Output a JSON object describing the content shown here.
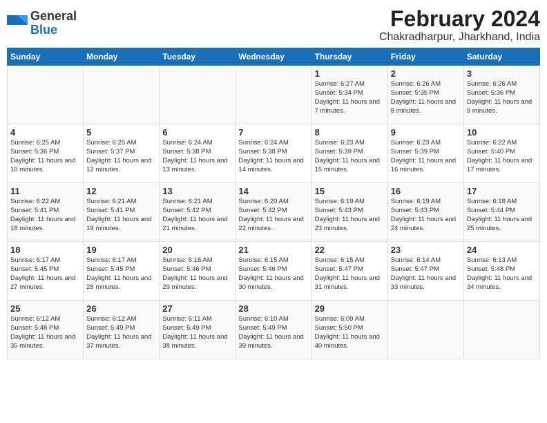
{
  "logo": {
    "general": "General",
    "blue": "Blue"
  },
  "title": "February 2024",
  "subtitle": "Chakradharpur, Jharkhand, India",
  "days_of_week": [
    "Sunday",
    "Monday",
    "Tuesday",
    "Wednesday",
    "Thursday",
    "Friday",
    "Saturday"
  ],
  "weeks": [
    [
      {
        "day": "",
        "text": ""
      },
      {
        "day": "",
        "text": ""
      },
      {
        "day": "",
        "text": ""
      },
      {
        "day": "",
        "text": ""
      },
      {
        "day": "1",
        "text": "Sunrise: 6:27 AM\nSunset: 5:34 PM\nDaylight: 11 hours and 7 minutes."
      },
      {
        "day": "2",
        "text": "Sunrise: 6:26 AM\nSunset: 5:35 PM\nDaylight: 11 hours and 8 minutes."
      },
      {
        "day": "3",
        "text": "Sunrise: 6:26 AM\nSunset: 5:36 PM\nDaylight: 11 hours and 9 minutes."
      }
    ],
    [
      {
        "day": "4",
        "text": "Sunrise: 6:25 AM\nSunset: 5:36 PM\nDaylight: 11 hours and 10 minutes."
      },
      {
        "day": "5",
        "text": "Sunrise: 6:25 AM\nSunset: 5:37 PM\nDaylight: 11 hours and 12 minutes."
      },
      {
        "day": "6",
        "text": "Sunrise: 6:24 AM\nSunset: 5:38 PM\nDaylight: 11 hours and 13 minutes."
      },
      {
        "day": "7",
        "text": "Sunrise: 6:24 AM\nSunset: 5:38 PM\nDaylight: 11 hours and 14 minutes."
      },
      {
        "day": "8",
        "text": "Sunrise: 6:23 AM\nSunset: 5:39 PM\nDaylight: 11 hours and 15 minutes."
      },
      {
        "day": "9",
        "text": "Sunrise: 6:23 AM\nSunset: 5:39 PM\nDaylight: 11 hours and 16 minutes."
      },
      {
        "day": "10",
        "text": "Sunrise: 6:22 AM\nSunset: 5:40 PM\nDaylight: 11 hours and 17 minutes."
      }
    ],
    [
      {
        "day": "11",
        "text": "Sunrise: 6:22 AM\nSunset: 5:41 PM\nDaylight: 11 hours and 18 minutes."
      },
      {
        "day": "12",
        "text": "Sunrise: 6:21 AM\nSunset: 5:41 PM\nDaylight: 11 hours and 19 minutes."
      },
      {
        "day": "13",
        "text": "Sunrise: 6:21 AM\nSunset: 5:42 PM\nDaylight: 11 hours and 21 minutes."
      },
      {
        "day": "14",
        "text": "Sunrise: 6:20 AM\nSunset: 5:42 PM\nDaylight: 11 hours and 22 minutes."
      },
      {
        "day": "15",
        "text": "Sunrise: 6:19 AM\nSunset: 5:43 PM\nDaylight: 11 hours and 23 minutes."
      },
      {
        "day": "16",
        "text": "Sunrise: 6:19 AM\nSunset: 5:43 PM\nDaylight: 11 hours and 24 minutes."
      },
      {
        "day": "17",
        "text": "Sunrise: 6:18 AM\nSunset: 5:44 PM\nDaylight: 11 hours and 25 minutes."
      }
    ],
    [
      {
        "day": "18",
        "text": "Sunrise: 6:17 AM\nSunset: 5:45 PM\nDaylight: 11 hours and 27 minutes."
      },
      {
        "day": "19",
        "text": "Sunrise: 6:17 AM\nSunset: 5:45 PM\nDaylight: 11 hours and 28 minutes."
      },
      {
        "day": "20",
        "text": "Sunrise: 6:16 AM\nSunset: 5:46 PM\nDaylight: 11 hours and 29 minutes."
      },
      {
        "day": "21",
        "text": "Sunrise: 6:15 AM\nSunset: 5:46 PM\nDaylight: 11 hours and 30 minutes."
      },
      {
        "day": "22",
        "text": "Sunrise: 6:15 AM\nSunset: 5:47 PM\nDaylight: 11 hours and 31 minutes."
      },
      {
        "day": "23",
        "text": "Sunrise: 6:14 AM\nSunset: 5:47 PM\nDaylight: 11 hours and 33 minutes."
      },
      {
        "day": "24",
        "text": "Sunrise: 6:13 AM\nSunset: 5:48 PM\nDaylight: 11 hours and 34 minutes."
      }
    ],
    [
      {
        "day": "25",
        "text": "Sunrise: 6:12 AM\nSunset: 5:48 PM\nDaylight: 11 hours and 35 minutes."
      },
      {
        "day": "26",
        "text": "Sunrise: 6:12 AM\nSunset: 5:49 PM\nDaylight: 11 hours and 37 minutes."
      },
      {
        "day": "27",
        "text": "Sunrise: 6:11 AM\nSunset: 5:49 PM\nDaylight: 11 hours and 38 minutes."
      },
      {
        "day": "28",
        "text": "Sunrise: 6:10 AM\nSunset: 5:49 PM\nDaylight: 11 hours and 39 minutes."
      },
      {
        "day": "29",
        "text": "Sunrise: 6:09 AM\nSunset: 5:50 PM\nDaylight: 11 hours and 40 minutes."
      },
      {
        "day": "",
        "text": ""
      },
      {
        "day": "",
        "text": ""
      }
    ]
  ]
}
